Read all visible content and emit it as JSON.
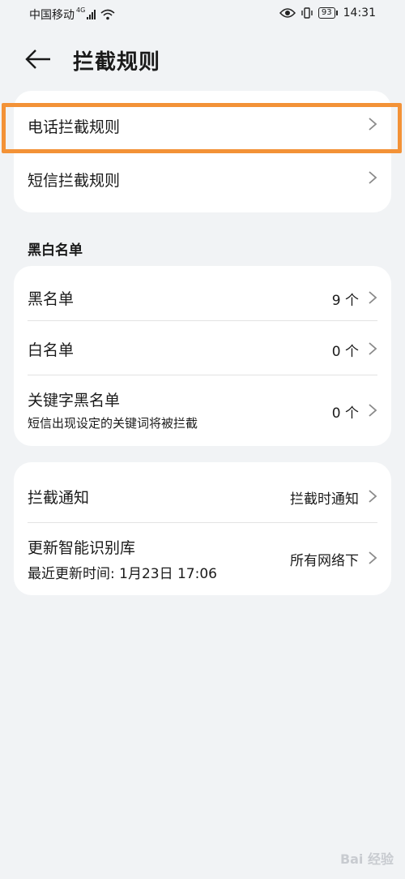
{
  "status_bar": {
    "carrier": "中国移动",
    "network": "4G",
    "battery": "93",
    "time": "14:31"
  },
  "header": {
    "title": "拦截规则"
  },
  "rules": [
    {
      "label": "电话拦截规则"
    },
    {
      "label": "短信拦截规则"
    }
  ],
  "blacklist_section": {
    "title": "黑白名单",
    "items": [
      {
        "label": "黑名单",
        "value": "9 个"
      },
      {
        "label": "白名单",
        "value": "0 个"
      },
      {
        "label": "关键字黑名单",
        "sub": "短信出现设定的关键词将被拦截",
        "value": "0 个"
      }
    ]
  },
  "settings": [
    {
      "label": "拦截通知",
      "value": "拦截时通知"
    },
    {
      "label": "更新智能识别库",
      "sub": "最近更新时间: 1月23日 17:06",
      "value": "所有网络下"
    }
  ],
  "watermark": "Bai 经验",
  "colors": {
    "background": "#f1f3f5",
    "card": "#ffffff",
    "highlight": "#f39237"
  }
}
